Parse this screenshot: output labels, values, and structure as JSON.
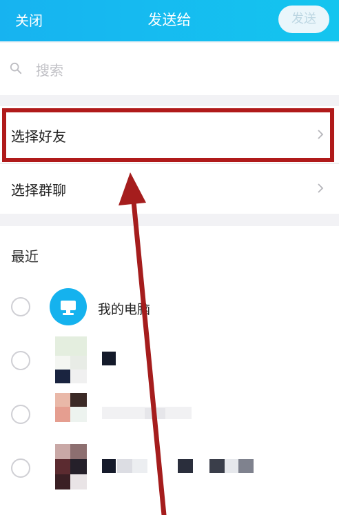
{
  "header": {
    "close_label": "关闭",
    "title": "发送给",
    "send_label": "发送"
  },
  "search": {
    "placeholder": "搜索"
  },
  "menu": {
    "select_friend": "选择好友",
    "select_group": "选择群聊"
  },
  "recent": {
    "section_title": "最近",
    "contacts": [
      {
        "name": "我的电脑",
        "avatar": "computer-icon"
      }
    ]
  },
  "colors": {
    "header_accent": "#17b3f0",
    "highlight": "#b01a1a",
    "arrow": "#a51d1d"
  }
}
